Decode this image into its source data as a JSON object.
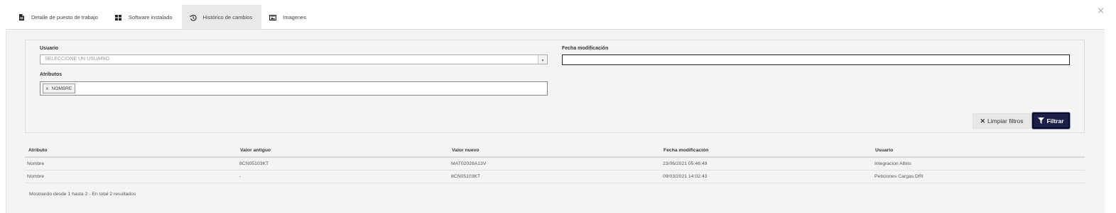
{
  "close_glyph": "×",
  "tabs": [
    {
      "label": "Detalle de puesto de trabajo",
      "icon": "file-icon",
      "active": false
    },
    {
      "label": "Software instalado",
      "icon": "windows-icon",
      "active": false
    },
    {
      "label": "Histórico de cambios",
      "icon": "history-icon",
      "active": true
    },
    {
      "label": "Imagenes",
      "icon": "image-icon",
      "active": false
    }
  ],
  "filters": {
    "usuario_label": "Usuario",
    "usuario_placeholder": "SELECCIONE UN USUARIO",
    "fecha_label": "Fecha modificación",
    "fecha_value": "",
    "atributos_label": "Atributos",
    "atributos_chips": [
      {
        "label": "NOMBRE"
      }
    ],
    "clear_label": "Limpiar filtros",
    "filter_label": "Filtrar"
  },
  "table": {
    "headers": [
      "Atributo",
      "Valor antiguo",
      "Valor nuevo",
      "Fecha modificación",
      "Usuario"
    ],
    "rows": [
      [
        "Nombre",
        "8CN05103KT",
        "MAT02028A13V",
        "23/06/2021 05:46:49",
        "Integracion Altiris"
      ],
      [
        "Nombre",
        "-",
        "8CN05103KT",
        "09/03/2021 14:02:43",
        "Peticiones Cargas DRI"
      ]
    ],
    "summary": "Mostrando desde 1 hasta 2 - En total 2 resultados"
  },
  "colors": {
    "primary_button": "#1c1f4a",
    "active_tab": "#e9e9e9",
    "panel_bg": "#f4f4f4"
  }
}
